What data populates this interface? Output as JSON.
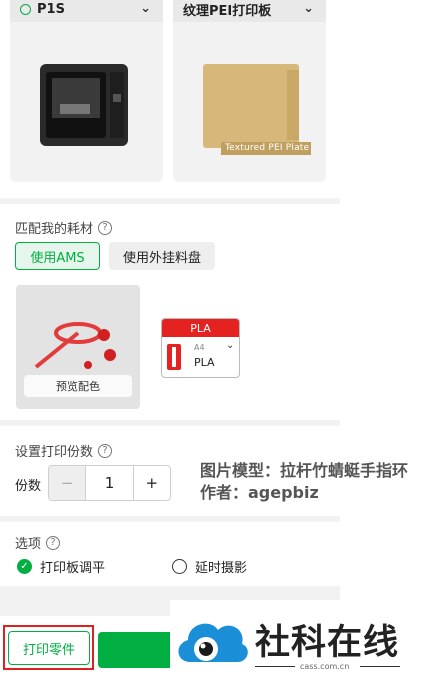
{
  "printer": {
    "name": "P1S"
  },
  "plate": {
    "name": "纹理PEI打印板",
    "image_caption": "Textured PEI Plate"
  },
  "filament_section": {
    "title": "匹配我的耗材",
    "ams_button": "使用AMS",
    "external_button": "使用外挂料盘",
    "preview_button": "预览配色",
    "slot": {
      "type": "PLA",
      "slot_label": "A4",
      "material": "PLA",
      "color": "#e52222"
    }
  },
  "copies_section": {
    "title": "设置打印份数",
    "label": "份数",
    "minus": "−",
    "value": "1",
    "plus": "+"
  },
  "watermark": {
    "line1": "图片模型：拉杆竹蜻蜓手指环",
    "line2": "作者：agepbiz"
  },
  "options_section": {
    "title": "选项",
    "bed_leveling": "打印板调平",
    "timelapse": "延时摄影"
  },
  "footer": {
    "print_part_button": "打印零件"
  },
  "logo": {
    "text": "社科在线",
    "subtext": "cass.com.cn"
  },
  "colors": {
    "accent": "#00ae42",
    "danger": "#e02020"
  }
}
